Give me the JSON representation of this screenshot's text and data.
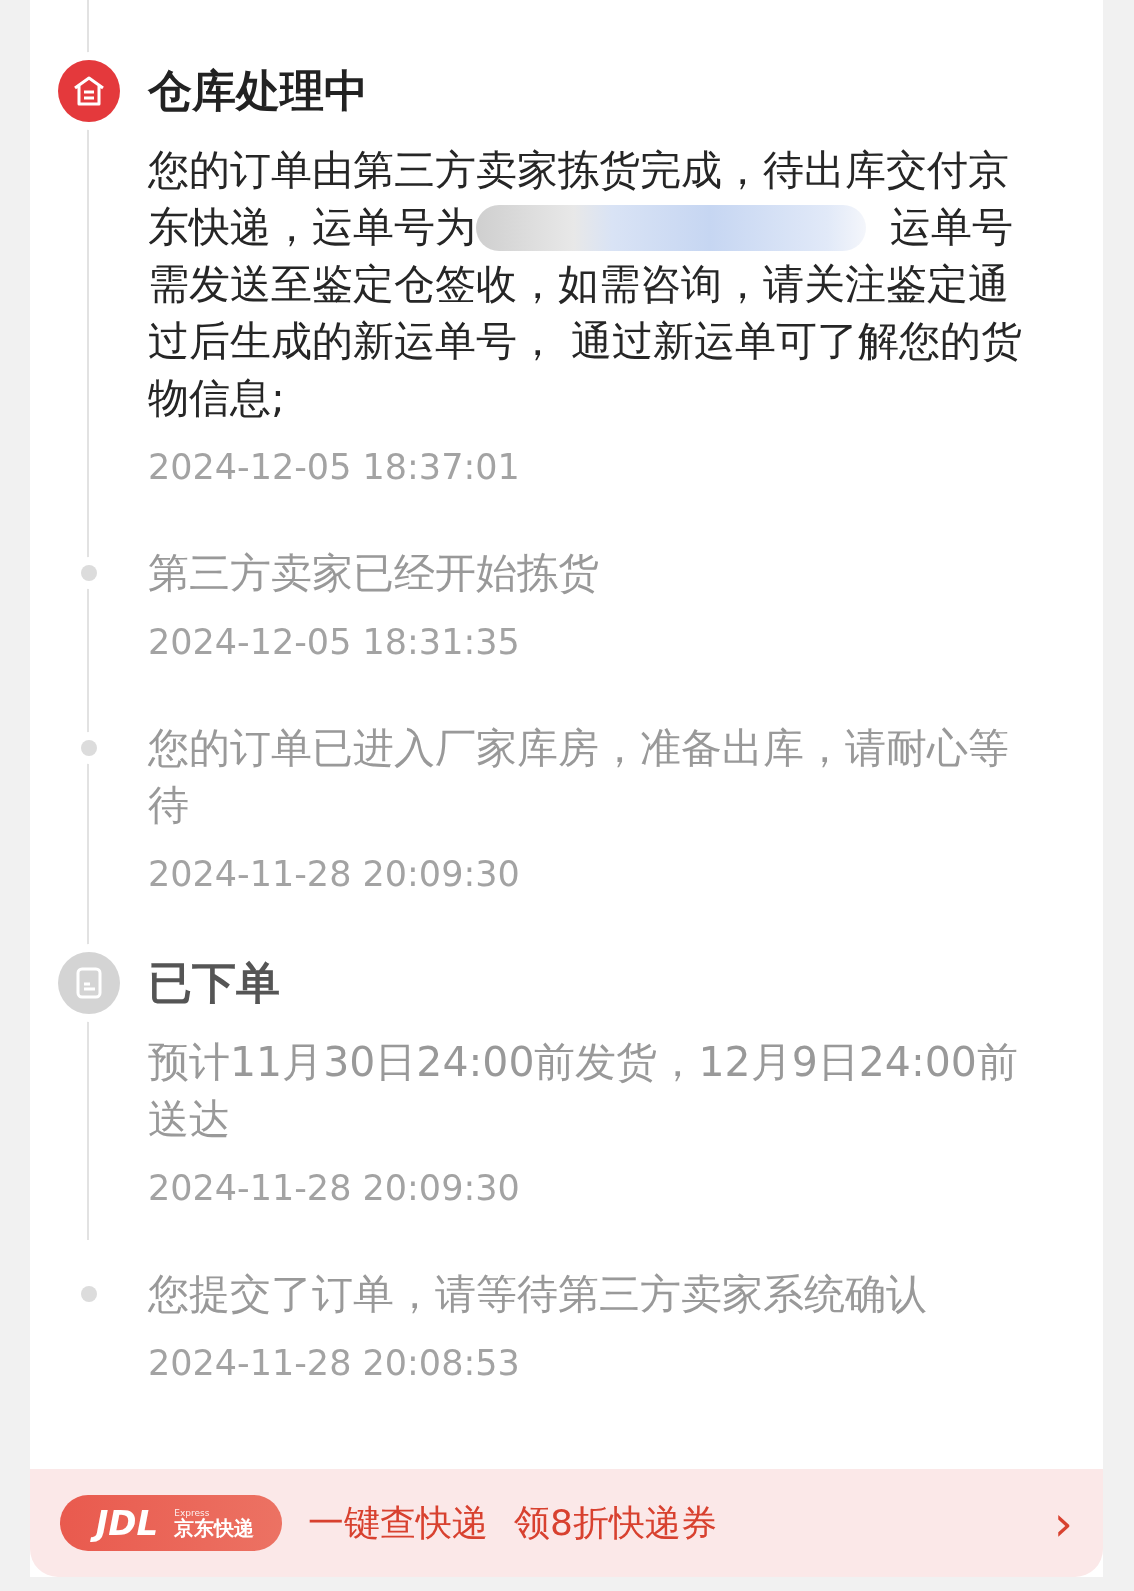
{
  "timeline": [
    {
      "kind": "warehouse",
      "active": true,
      "title": "仓库处理中"
    },
    {
      "kind": "detail",
      "active": true,
      "text_line_1": "您的订单由第三方卖家拣货完成，待出库交付京",
      "text_before_redaction": "东快递，运单号为",
      "text_after_redaction": "运单号",
      "text_rest": "需发送至鉴定仓签收，如需咨询，请关注鉴定通过后生成的新运单号， 通过新运单可了解您的货物信息;",
      "time": "2024-12-05 18:37:01"
    },
    {
      "kind": "event",
      "text": "第三方卖家已经开始拣货",
      "time": "2024-12-05 18:31:35"
    },
    {
      "kind": "event",
      "text": "您的订单已进入厂家库房，准备出库，请耐心等待",
      "time": "2024-11-28 20:09:30"
    },
    {
      "kind": "placed",
      "active": false,
      "title": "已下单"
    },
    {
      "kind": "detail",
      "active": false,
      "text": "预计11月30日24:00前发货，12月9日24:00前送达",
      "time": "2024-11-28 20:09:30"
    },
    {
      "kind": "event",
      "text": "您提交了订单，请等待第三方卖家系统确认",
      "time": "2024-11-28 20:08:53"
    }
  ],
  "banner": {
    "logo_mark": "JDL",
    "logo_sub": "Express",
    "logo_name": "京东快递",
    "texts": [
      "一键查快递",
      "领8折快递券"
    ],
    "arrow": "›"
  }
}
